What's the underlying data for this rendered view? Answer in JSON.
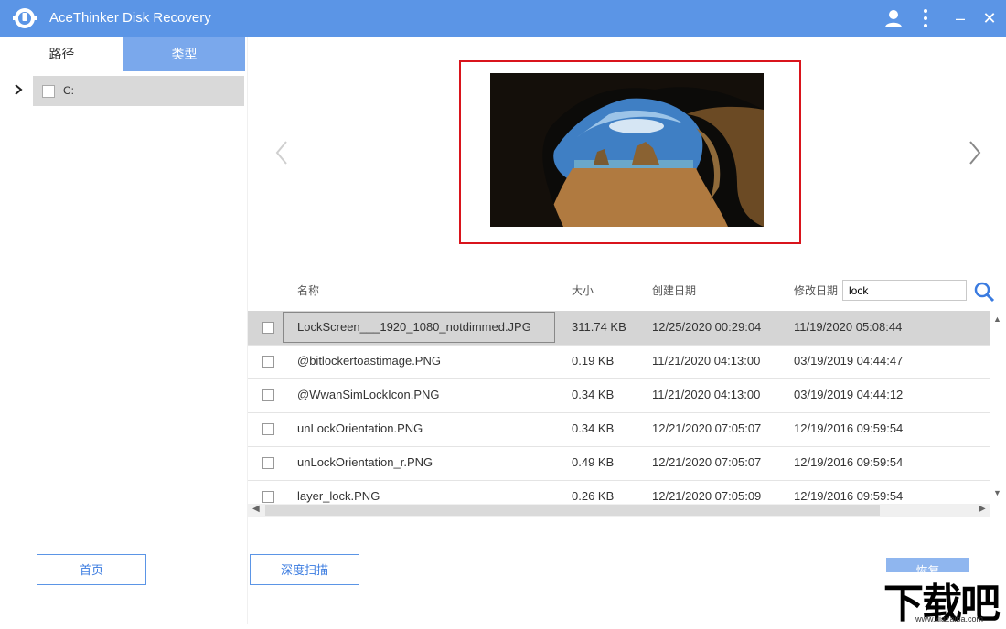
{
  "app": {
    "title": "AceThinker Disk Recovery",
    "accent_color": "#5b95e6"
  },
  "window_controls": {
    "user_icon": "user-icon",
    "menu_icon": "more-vertical-icon",
    "minimize_label": "–",
    "close_label": "✕"
  },
  "left_panel": {
    "tabs": [
      {
        "label": "路径",
        "active": false
      },
      {
        "label": "类型",
        "active": true
      }
    ],
    "tree": {
      "label": "C:",
      "checked": false
    }
  },
  "preview": {
    "image_desc_icon": "cave-beach-photo",
    "prev_arrow": "chevron-left-icon",
    "next_arrow": "chevron-right-icon"
  },
  "table": {
    "headers": {
      "name": "名称",
      "size": "大小",
      "created": "创建日期",
      "modified": "修改日期"
    },
    "search_value": "lock",
    "rows": [
      {
        "name": "LockScreen___1920_1080_notdimmed.JPG",
        "size": "311.74 KB",
        "created": "12/25/2020 00:29:04",
        "modified": "11/19/2020 05:08:44",
        "selected": true
      },
      {
        "name": "@bitlockertoastimage.PNG",
        "size": "0.19 KB",
        "created": "11/21/2020 04:13:00",
        "modified": "03/19/2019 04:44:47",
        "selected": false
      },
      {
        "name": "@WwanSimLockIcon.PNG",
        "size": "0.34 KB",
        "created": "11/21/2020 04:13:00",
        "modified": "03/19/2019 04:44:12",
        "selected": false
      },
      {
        "name": "unLockOrientation.PNG",
        "size": "0.34 KB",
        "created": "12/21/2020 07:05:07",
        "modified": "12/19/2016 09:59:54",
        "selected": false
      },
      {
        "name": "unLockOrientation_r.PNG",
        "size": "0.49 KB",
        "created": "12/21/2020 07:05:07",
        "modified": "12/19/2016 09:59:54",
        "selected": false
      },
      {
        "name": "layer_lock.PNG",
        "size": "0.26 KB",
        "created": "12/21/2020 07:05:09",
        "modified": "12/19/2016 09:59:54",
        "selected": false
      }
    ]
  },
  "buttons": {
    "home": "首页",
    "deep_scan": "深度扫描",
    "recover": "恢复"
  },
  "watermark": {
    "title": "下载吧",
    "url": "www.xiazaiba.com"
  }
}
